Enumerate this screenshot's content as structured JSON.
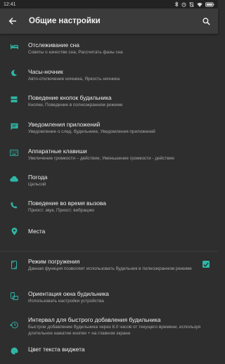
{
  "status_bar": {
    "time": "12:41"
  },
  "app_bar": {
    "title": "Общие настройки"
  },
  "colors": {
    "accent": "#2fb7a6",
    "icon": "#2fb7a6",
    "background": "#2e2e2e",
    "appbar": "#3b3b3b"
  },
  "settings": [
    {
      "title": "Отслеживание сна",
      "subtitle": "Советы о качестве сна, Рассчитать фазы сна",
      "icon": "bed-icon"
    },
    {
      "title": "Часы-ночник",
      "subtitle": "Авто-отключение ночника, Яркость ночника",
      "icon": "moon-icon"
    },
    {
      "title": "Поведение кнопок будильника",
      "subtitle": "Кнопки, Поведение в полноэкранном режиме",
      "icon": "buttons-icon"
    },
    {
      "title": "Уведомления приложений",
      "subtitle": "Уведомление о след. будильнике, Уведомления приложений",
      "icon": "message-icon"
    },
    {
      "title": "Аппаратные клавиши",
      "subtitle": "Увеличение громкости – действие, Уменьшение громкости - действие",
      "icon": "keyboard-icon"
    },
    {
      "title": "Погода",
      "subtitle": "Цельсий",
      "icon": "cloud-icon"
    },
    {
      "title": "Поведение во время вызова",
      "subtitle": "Приост. звук, Приост. вибрацию",
      "icon": "phone-icon"
    },
    {
      "title": "Места",
      "subtitle": "",
      "icon": "location-icon"
    },
    {
      "title": "Режим погружения",
      "subtitle": "Данная функция позволяет использовать будильник в полноэкранном режиме",
      "icon": "phone-fullscreen-icon",
      "checked": true
    },
    {
      "title": "Ориентация окна будильника",
      "subtitle": "Использовать настройки устройства",
      "icon": "rotate-icon"
    },
    {
      "title": "Интервал для быстрого добавления будильника",
      "subtitle": "Быстрое добавление будильника через 8.0 часов от текущего времени, используя длительное нажатие кнопки + на главном экране",
      "icon": "timer-add-icon"
    },
    {
      "title": "Цвет текста виджета",
      "subtitle": "",
      "icon": "palette-icon"
    }
  ]
}
